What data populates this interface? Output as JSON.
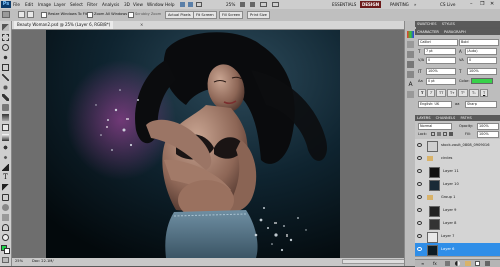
{
  "app": {
    "logo": "Ps"
  },
  "menubar": {
    "items": [
      "File",
      "Edit",
      "Image",
      "Layer",
      "Select",
      "Filter",
      "Analysis",
      "3D",
      "View",
      "Window",
      "Help"
    ],
    "zoom": "25%",
    "workspaces": [
      "ESSENTIALS",
      "DESIGN",
      "PAINTING"
    ],
    "cs_live": "CS Live"
  },
  "options": {
    "resize_windows": "Resize Windows To Fit",
    "zoom_all": "Zoom All Windows",
    "scrubby": "Scrubby Zoom",
    "actual_pixels": "Actual Pixels",
    "fit_screen": "Fit Screen",
    "fill_screen": "Fill Screen",
    "print_size": "Print Size"
  },
  "document": {
    "tab_title": "Beauty Woman2.psd @ 25% (Layer 6, RGB/8*)",
    "status_zoom": "25%",
    "status_doc": "Doc: 22.1M/"
  },
  "character": {
    "tabs": [
      "CHARACTER",
      "PARAGRAPH"
    ],
    "font_family": "Calibri",
    "font_style": "Bold",
    "font_size": "7 pt",
    "leading": "(Auto)",
    "kerning": "0",
    "tracking": "0",
    "vscale": "100%",
    "hscale": "100%",
    "baseline": "0 pt",
    "color_label": "Color:",
    "color_value": "#37d14a",
    "language": "English: UK",
    "aa": "aa",
    "aa_method": "Sharp"
  },
  "mini_panels": {
    "swatches_tab": "SWATCHES",
    "styles_tab": "STYLES"
  },
  "layers": {
    "tabs": [
      "LAYERS",
      "CHANNELS",
      "PATHS"
    ],
    "blend_mode": "Normal",
    "opacity_label": "Opacity:",
    "opacity": "100%",
    "lock_label": "Lock:",
    "fill_label": "Fill:",
    "fill": "100%",
    "rows": [
      {
        "name": "stock-vault_0808_0909016",
        "selected": false
      },
      {
        "name": "circles",
        "selected": false
      },
      {
        "name": "Layer 11",
        "selected": false
      },
      {
        "name": "Layer 10",
        "selected": false
      },
      {
        "name": "Group 1",
        "selected": false
      },
      {
        "name": "Layer 9",
        "selected": false
      },
      {
        "name": "Layer 8",
        "selected": false
      },
      {
        "name": "Layer 7",
        "selected": false
      },
      {
        "name": "Layer 6",
        "selected": true
      }
    ]
  },
  "colors": {
    "accent": "#2f8ee8",
    "fg_swatch": "#1fd34a",
    "bg_swatch": "#ffffff"
  }
}
